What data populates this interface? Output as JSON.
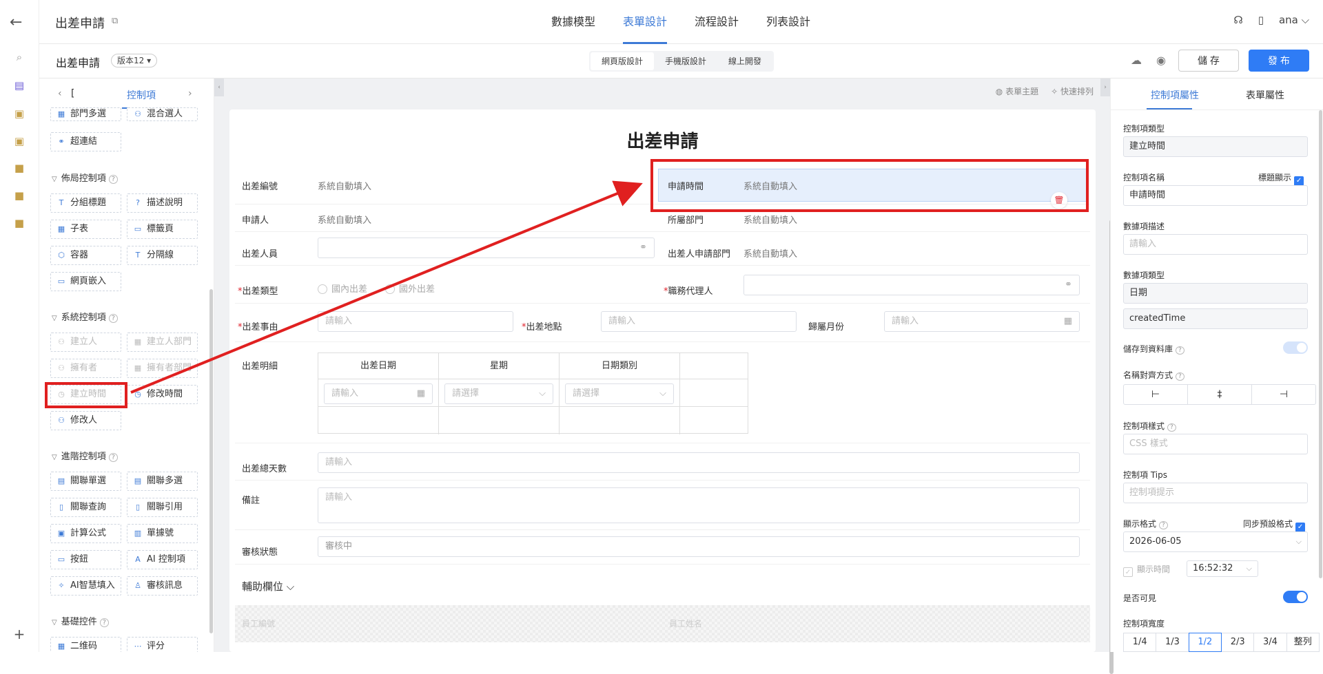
{
  "header": {
    "app_title": "出差申請",
    "tabs": [
      {
        "label": "數據模型"
      },
      {
        "label": "表單設計"
      },
      {
        "label": "流程設計"
      },
      {
        "label": "列表設計"
      }
    ],
    "user": "ana"
  },
  "subbar": {
    "form_title": "出差申請",
    "version": "版本12",
    "modes": [
      {
        "label": "網頁版設計"
      },
      {
        "label": "手機版設計"
      },
      {
        "label": "線上開發"
      }
    ],
    "save_label": "儲 存",
    "publish_label": "發 布"
  },
  "palette": {
    "tab_cut": "[",
    "tab_label": "控制項",
    "top_items": [
      "部門多選",
      "混合選人",
      "超連結"
    ],
    "sections": [
      {
        "title": "佈局控制項",
        "items": [
          "分組標題",
          "描述說明",
          "子表",
          "標籤頁",
          "容器",
          "分隔線",
          "網頁嵌入"
        ]
      },
      {
        "title": "系統控制項",
        "items": [
          "建立人",
          "建立人部門",
          "擁有者",
          "擁有者部門",
          "建立時間",
          "修改時間",
          "修改人"
        ]
      },
      {
        "title": "進階控制項",
        "items": [
          "關聯單選",
          "關聯多選",
          "關聯查詢",
          "關聯引用",
          "計算公式",
          "單據號",
          "按鈕",
          "AI 控制項",
          "AI智慧填入",
          "審核訊息"
        ]
      },
      {
        "title": "基礎控件",
        "items": [
          "二维码",
          "评分"
        ]
      }
    ]
  },
  "canvas": {
    "tools": [
      "表單主題",
      "快速排列"
    ],
    "title": "出差申請",
    "fields": {
      "trip_no": {
        "label": "出差編號",
        "value": "系統自動填入"
      },
      "apply_time": {
        "label": "申請時間",
        "value": "系統自動填入"
      },
      "applicant": {
        "label": "申請人",
        "value": "系統自動填入"
      },
      "dept": {
        "label": "所屬部門",
        "value": "系統自動填入"
      },
      "traveler": {
        "label": "出差人員"
      },
      "traveler_dept": {
        "label": "出差人申請部門",
        "value": "系統自動填入"
      },
      "trip_type": {
        "label": "出差類型",
        "options": [
          "國內出差",
          "國外出差"
        ]
      },
      "agent": {
        "label": "職務代理人"
      },
      "reason": {
        "label": "出差事由",
        "placeholder": "請輸入"
      },
      "location": {
        "label": "出差地點",
        "placeholder": "請輸入"
      },
      "month": {
        "label": "歸屬月份",
        "placeholder": "請輸入"
      },
      "detail": {
        "label": "出差明細",
        "columns": [
          "出差日期",
          "星期",
          "日期類別"
        ],
        "date_ph": "請輸入",
        "select_ph": "請選擇"
      },
      "total_days": {
        "label": "出差總天數",
        "placeholder": "請輸入"
      },
      "remark": {
        "label": "備註",
        "placeholder": "請輸入"
      },
      "status": {
        "label": "審核狀態",
        "value": "審核中"
      }
    },
    "aux_title": "輔助欄位",
    "aux_fields": [
      "員工編號",
      "員工姓名"
    ]
  },
  "props": {
    "tabs": [
      "控制項屬性",
      "表單屬性"
    ],
    "type_label": "控制項類型",
    "type_value": "建立時間",
    "name_label": "控制項名稱",
    "show_title_label": "標題顯示",
    "name_value": "申請時間",
    "desc_label": "數據項描述",
    "desc_ph": "請輸入",
    "dtype_label": "數據項類型",
    "dtype_value": "日期",
    "field_id": "createdTime",
    "save_db_label": "儲存到資料庫",
    "align_label": "名稱對齊方式",
    "style_label": "控制項樣式",
    "style_ph": "CSS 樣式",
    "tips_label": "控制項 Tips",
    "tips_ph": "控制項提示",
    "format_label": "顯示格式",
    "sync_label": "同步預設格式",
    "format_value": "2026-06-05",
    "show_time_label": "顯示時間",
    "time_value": "16:52:32",
    "visible_label": "是否可見",
    "width_label": "控制項寬度",
    "widths": [
      "1/4",
      "1/3",
      "1/2",
      "2/3",
      "3/4",
      "整列"
    ]
  },
  "colors": {
    "accent": "#2f7cf5",
    "annotation": "#e02020",
    "required": "#e0212b"
  }
}
